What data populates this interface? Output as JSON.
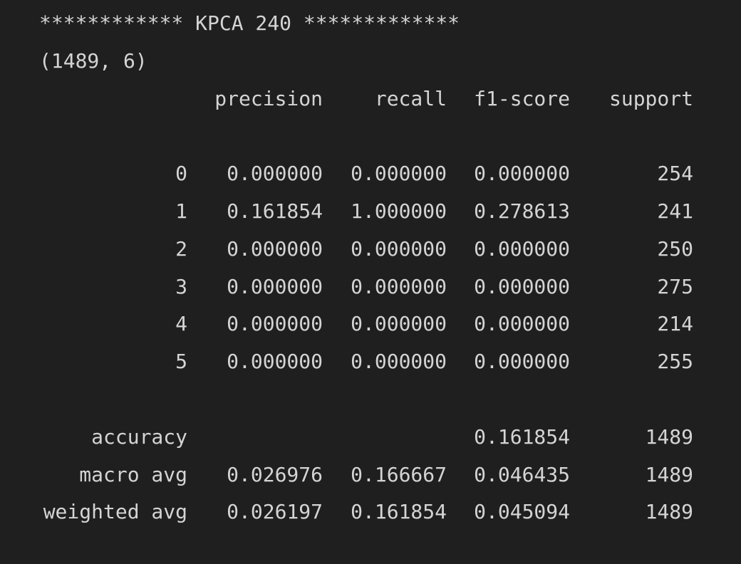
{
  "header_line": "************ KPCA 240 *************",
  "shape_line": "(1489, 6)",
  "columns": {
    "precision": "precision",
    "recall": "recall",
    "f1": "f1-score",
    "support": "support"
  },
  "rows": [
    {
      "label": "0",
      "precision": "0.000000",
      "recall": "0.000000",
      "f1": "0.000000",
      "support": "254"
    },
    {
      "label": "1",
      "precision": "0.161854",
      "recall": "1.000000",
      "f1": "0.278613",
      "support": "241"
    },
    {
      "label": "2",
      "precision": "0.000000",
      "recall": "0.000000",
      "f1": "0.000000",
      "support": "250"
    },
    {
      "label": "3",
      "precision": "0.000000",
      "recall": "0.000000",
      "f1": "0.000000",
      "support": "275"
    },
    {
      "label": "4",
      "precision": "0.000000",
      "recall": "0.000000",
      "f1": "0.000000",
      "support": "214"
    },
    {
      "label": "5",
      "precision": "0.000000",
      "recall": "0.000000",
      "f1": "0.000000",
      "support": "255"
    }
  ],
  "summary": [
    {
      "label": "accuracy",
      "precision": "",
      "recall": "",
      "f1": "0.161854",
      "support": "1489"
    },
    {
      "label": "macro avg",
      "precision": "0.026976",
      "recall": "0.166667",
      "f1": "0.046435",
      "support": "1489"
    },
    {
      "label": "weighted avg",
      "precision": "0.026197",
      "recall": "0.161854",
      "f1": "0.045094",
      "support": "1489"
    }
  ]
}
